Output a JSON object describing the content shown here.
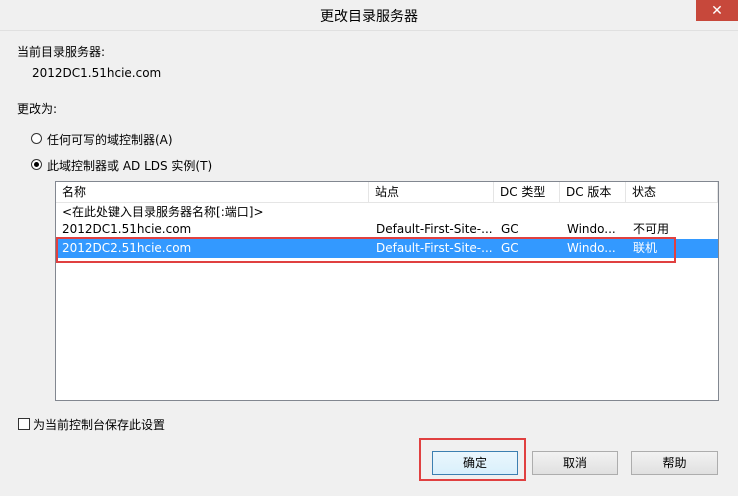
{
  "window": {
    "title": "更改目录服务器",
    "close_symbol": "✕"
  },
  "current_server": {
    "label": "当前目录服务器:",
    "value": "2012DC1.51hcie.com"
  },
  "change_to": {
    "label": "更改为:",
    "options": [
      {
        "label": "任何可写的域控制器(A)",
        "selected": false
      },
      {
        "label": "此域控制器或 AD LDS 实例(T)",
        "selected": true
      }
    ]
  },
  "table": {
    "columns": [
      "名称",
      "站点",
      "DC 类型",
      "DC 版本",
      "状态"
    ],
    "rows": [
      {
        "name": "<在此处键入目录服务器名称[:端口]>",
        "site": "",
        "dc_type": "",
        "dc_version": "",
        "status": ""
      },
      {
        "name": "2012DC1.51hcie.com",
        "site": "Default-First-Site-...",
        "dc_type": "GC",
        "dc_version": "Windo...",
        "status": "不可用"
      },
      {
        "name": "2012DC2.51hcie.com",
        "site": "Default-First-Site-...",
        "dc_type": "GC",
        "dc_version": "Windo...",
        "status": "联机"
      }
    ],
    "selected_row_index": 2
  },
  "save_setting": {
    "label": "为当前控制台保存此设置",
    "checked": false
  },
  "buttons": {
    "ok": "确定",
    "cancel": "取消",
    "help": "帮助"
  },
  "colors": {
    "selection": "#3399ff",
    "highlight_box": "#e04040",
    "close_button": "#c7483b"
  }
}
